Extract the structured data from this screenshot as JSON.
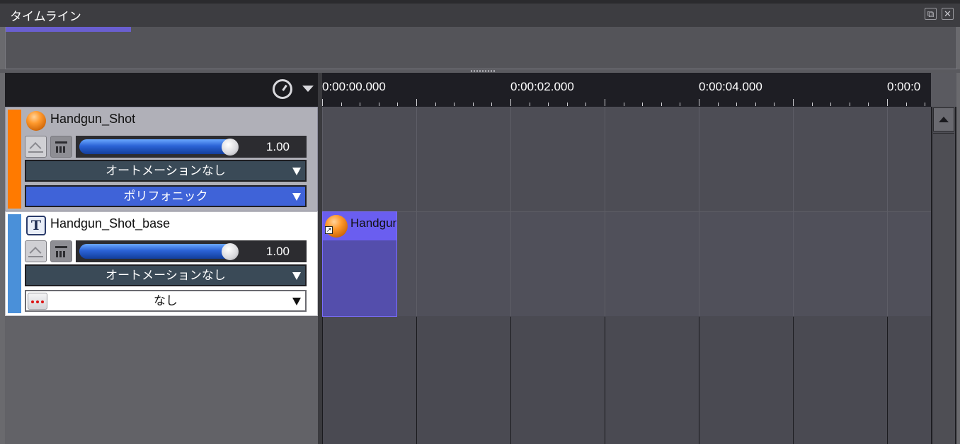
{
  "window": {
    "title": "タイムライン",
    "restore_glyph": "⧉",
    "close_glyph": "✕"
  },
  "timeline": {
    "ruler_labels": [
      "0:00:00.000",
      "0:00:02.000",
      "0:00:04.000",
      "0:00:0"
    ]
  },
  "tracks": [
    {
      "name": "Handgun_Shot",
      "icon": "orange-orb-icon",
      "stripe_color": "#ff7a00",
      "volume": "1.00",
      "volume_level": 0.92,
      "automation": "オートメーションなし",
      "mode": "ポリフォニック"
    },
    {
      "name": "Handgun_Shot_base",
      "icon": "text-t-icon",
      "icon_letter": "T",
      "stripe_color": "#4a90d9",
      "volume": "1.00",
      "volume_level": 0.92,
      "automation": "オートメーションなし",
      "mode": "なし"
    }
  ],
  "clip": {
    "name": "Handgun_Shot",
    "link_glyph": "↗"
  },
  "colors": {
    "clip_fill": "#544eac",
    "clip_head": "#6a5ef0",
    "accent_blue": "#3f63d8"
  }
}
